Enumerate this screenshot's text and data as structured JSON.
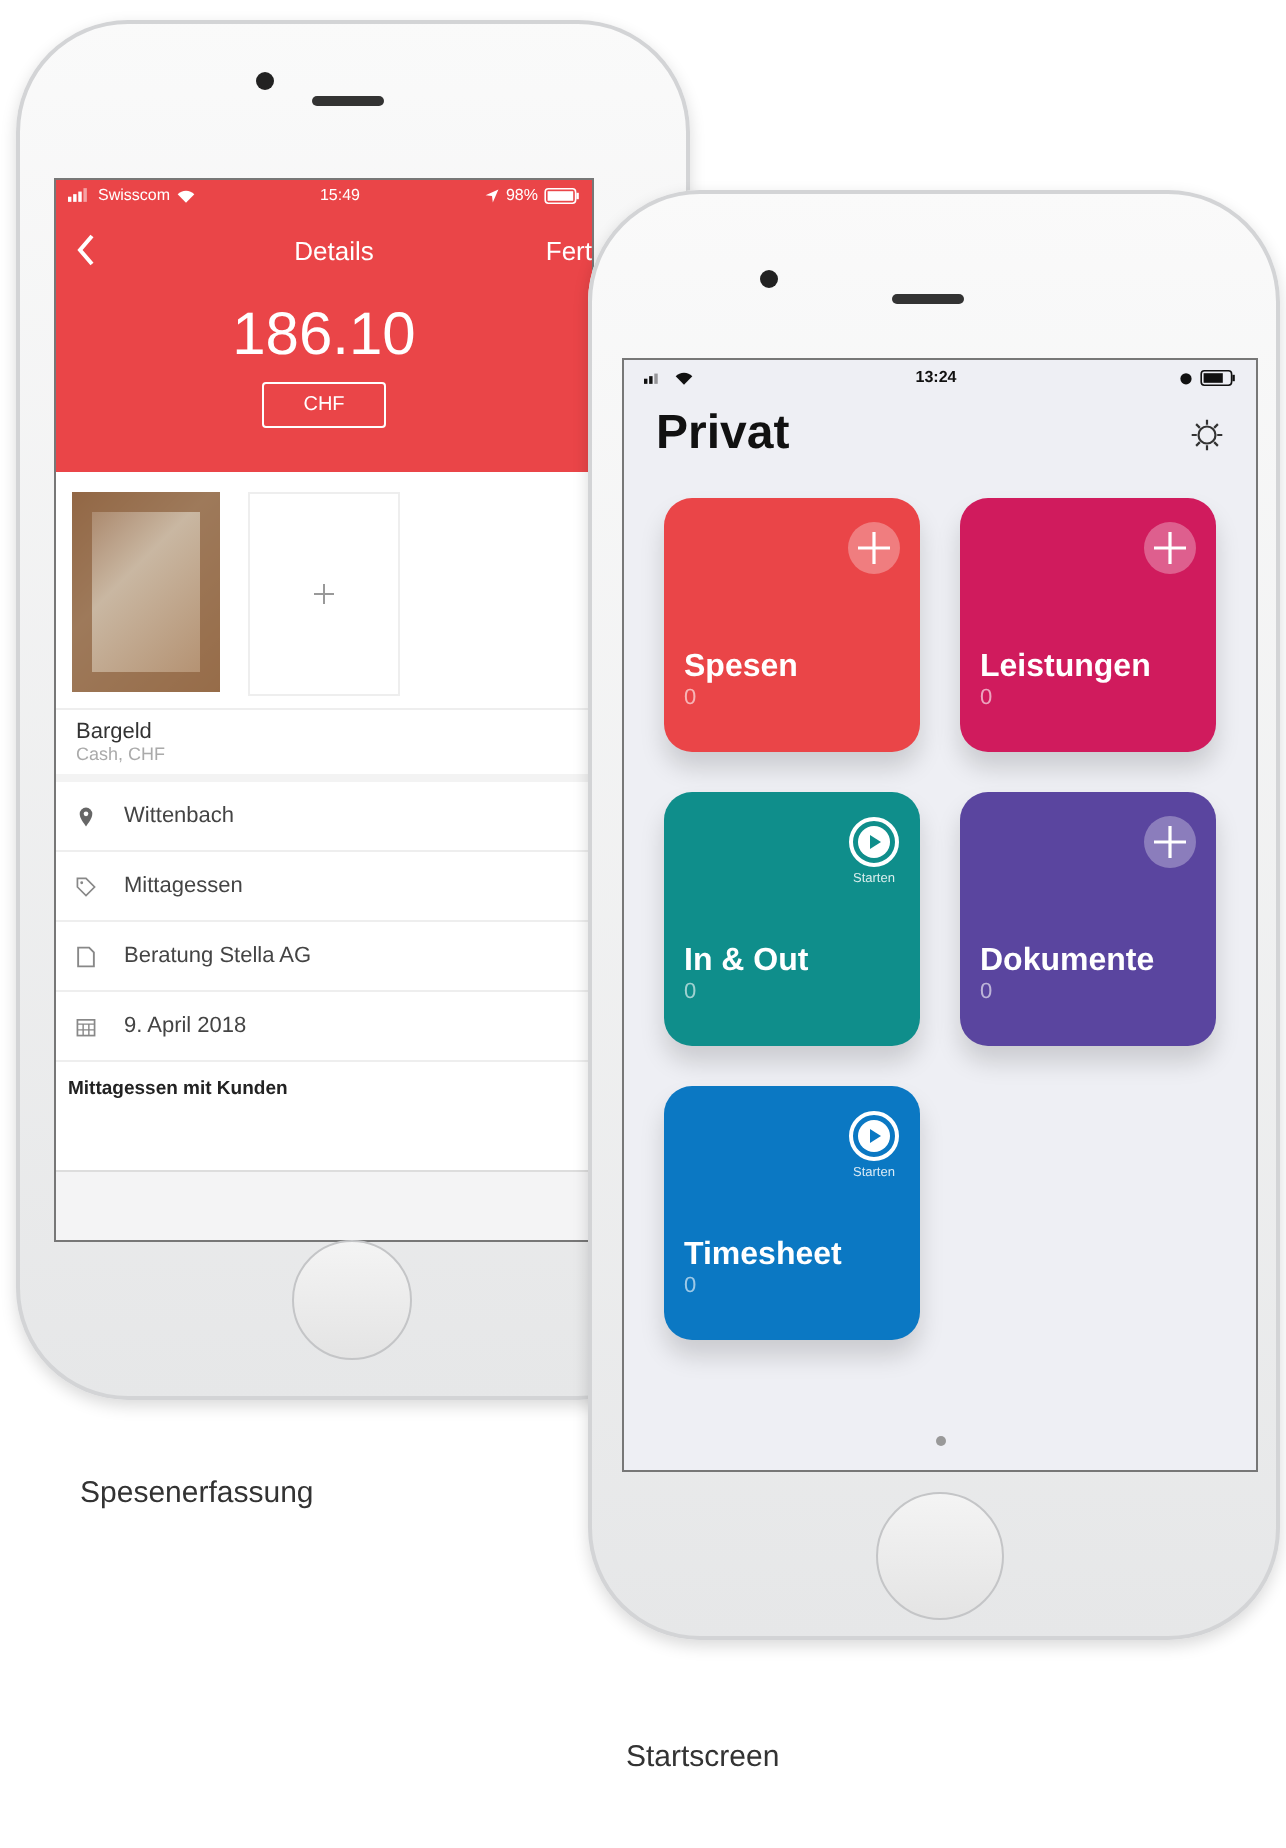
{
  "expense_phone": {
    "status_bar": {
      "carrier": "Swisscom",
      "time": "15:49",
      "battery": "98%"
    },
    "nav": {
      "title": "Details",
      "action": "Fert"
    },
    "amount": "186.10",
    "currency": "CHF",
    "payment": {
      "title": "Bargeld",
      "subtitle": "Cash, CHF"
    },
    "fields": [
      {
        "kind": "location",
        "text": "Wittenbach"
      },
      {
        "kind": "tag",
        "text": "Mittagessen"
      },
      {
        "kind": "document",
        "text": "Beratung Stella AG"
      },
      {
        "kind": "date",
        "text": "9. April 2018"
      }
    ],
    "note": "Mittagessen mit Kunden",
    "caption": "Spesenerfassung"
  },
  "start_phone": {
    "status_bar": {
      "time": "13:24"
    },
    "title": "Privat",
    "tiles": [
      {
        "kind": "add",
        "name": "Spesen",
        "count": "0",
        "color": "#ea4548"
      },
      {
        "kind": "add",
        "name": "Leistungen",
        "count": "0",
        "color": "#d01b5d"
      },
      {
        "kind": "start",
        "name": "In & Out",
        "count": "0",
        "color": "#0f8e8b",
        "action": "Starten"
      },
      {
        "kind": "add",
        "name": "Dokumente",
        "count": "0",
        "color": "#5a459f"
      },
      {
        "kind": "start",
        "name": "Timesheet",
        "count": "0",
        "color": "#0b78c3",
        "action": "Starten"
      }
    ],
    "caption": "Startscreen"
  }
}
